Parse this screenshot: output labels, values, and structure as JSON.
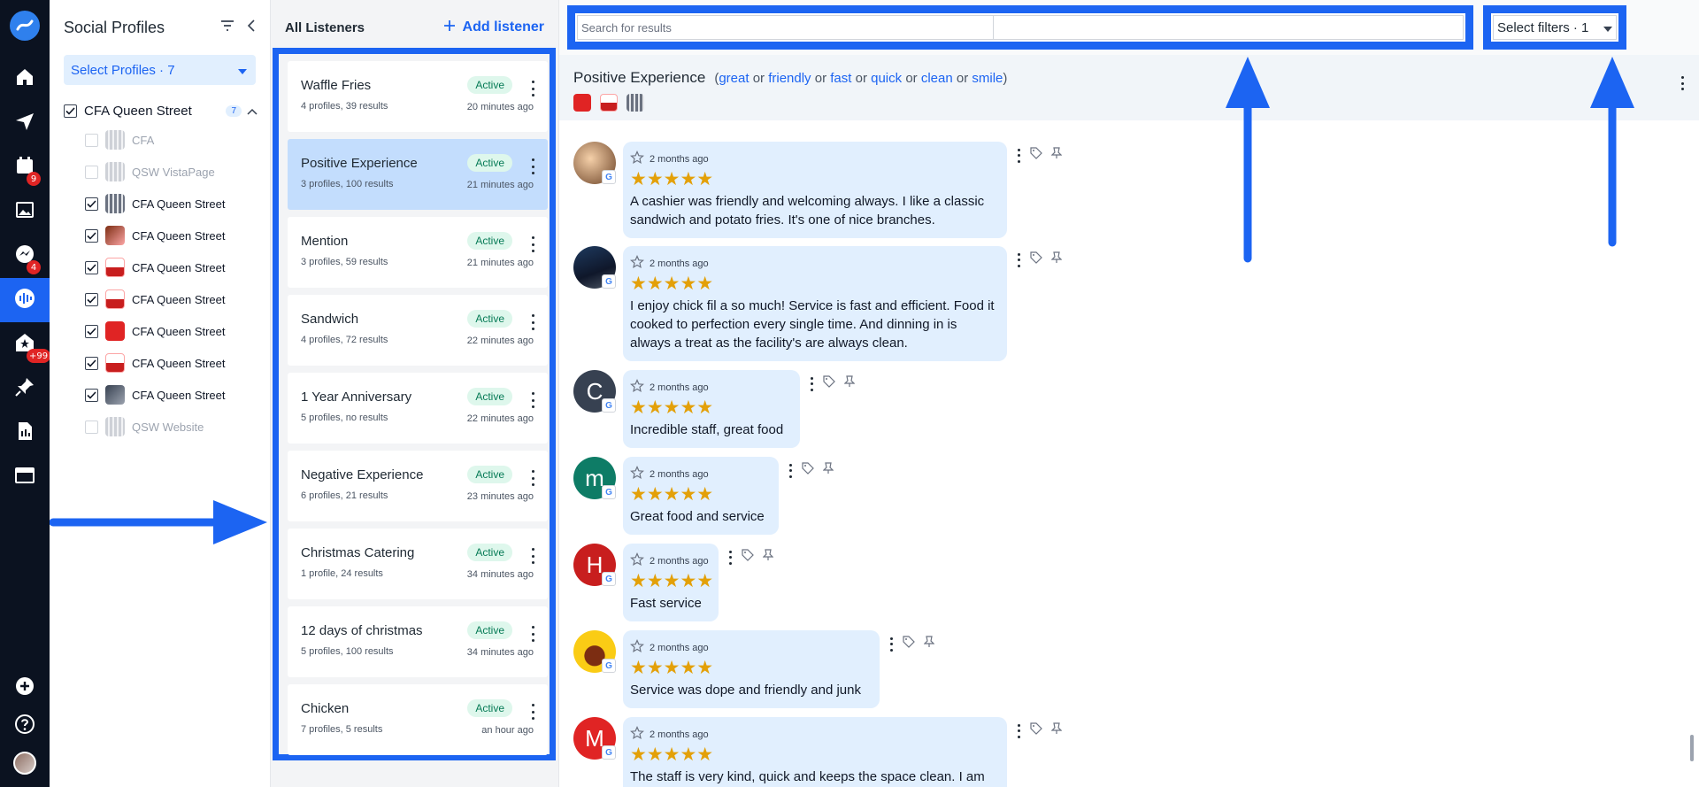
{
  "rail": {
    "items": [
      {
        "icon": "home-icon"
      },
      {
        "icon": "send-icon"
      },
      {
        "icon": "calendar-icon",
        "badge": "9"
      },
      {
        "icon": "image-icon"
      },
      {
        "icon": "messenger-icon",
        "badge": "4"
      },
      {
        "icon": "listening-icon",
        "active": true
      },
      {
        "icon": "reviews-icon",
        "badge": "+99"
      },
      {
        "icon": "pin-icon"
      },
      {
        "icon": "report-icon"
      },
      {
        "icon": "browser-icon"
      }
    ]
  },
  "profiles": {
    "title": "Social Profiles",
    "select_label": "Select Profiles · 7",
    "group": {
      "label": "CFA Queen Street",
      "count": "7"
    },
    "items": [
      {
        "label": "CFA",
        "checked": false,
        "dim": true
      },
      {
        "label": "QSW VistaPage",
        "checked": false,
        "dim": true
      },
      {
        "label": "CFA Queen Street",
        "checked": true
      },
      {
        "label": "CFA Queen Street",
        "checked": true
      },
      {
        "label": "CFA Queen Street",
        "checked": true
      },
      {
        "label": "CFA Queen Street",
        "checked": true
      },
      {
        "label": "CFA Queen Street",
        "checked": true
      },
      {
        "label": "CFA Queen Street",
        "checked": true
      },
      {
        "label": "CFA Queen Street",
        "checked": true
      },
      {
        "label": "QSW Website",
        "checked": false,
        "dim": true
      }
    ]
  },
  "listeners": {
    "title": "All Listeners",
    "add_label": "Add listener",
    "items": [
      {
        "name": "Waffle Fries",
        "meta": "4 profiles, 39 results",
        "status": "Active",
        "time": "20 minutes ago"
      },
      {
        "name": "Positive Experience",
        "meta": "3 profiles, 100 results",
        "status": "Active",
        "time": "21 minutes ago",
        "selected": true
      },
      {
        "name": "Mention",
        "meta": "3 profiles, 59 results",
        "status": "Active",
        "time": "21 minutes ago"
      },
      {
        "name": "Sandwich",
        "meta": "4 profiles, 72 results",
        "status": "Active",
        "time": "22 minutes ago"
      },
      {
        "name": "1 Year Anniversary",
        "meta": "5 profiles, no results",
        "status": "Active",
        "time": "22 minutes ago"
      },
      {
        "name": "Negative Experience",
        "meta": "6 profiles, 21 results",
        "status": "Active",
        "time": "23 minutes ago"
      },
      {
        "name": "Christmas Catering",
        "meta": "1 profile, 24 results",
        "status": "Active",
        "time": "34 minutes ago"
      },
      {
        "name": "12 days of christmas",
        "meta": "5 profiles, 100 results",
        "status": "Active",
        "time": "34 minutes ago"
      },
      {
        "name": "Chicken",
        "meta": "7 profiles, 5 results",
        "status": "Active",
        "time": "an hour ago"
      }
    ]
  },
  "search": {
    "placeholder": "Search for results"
  },
  "filters": {
    "label": "Select filters · 1"
  },
  "active_listener": {
    "title": "Positive Experience",
    "keywords": [
      "great",
      "friendly",
      "fast",
      "quick",
      "clean",
      "smile"
    ],
    "or_word": "or"
  },
  "reviews": [
    {
      "avatar": "photo",
      "time": "2 months ago",
      "stars": "★★★★★",
      "text": "A cashier was friendly and welcoming always. I like a classic sandwich and potato fries. It's one of nice branches."
    },
    {
      "avatar": "photo-dark",
      "time": "2 months ago",
      "stars": "★★★★★",
      "text": "I enjoy chick fil a so much! Service is fast and efficient. Food it cooked to perfection every single time. And dinning in is always a treat as the facility's are always clean."
    },
    {
      "avatar": "C",
      "color": "#374151",
      "time": "2 months ago",
      "stars": "★★★★★",
      "text": "Incredible staff, great food"
    },
    {
      "avatar": "m",
      "color": "#0e7c66",
      "time": "2 months ago",
      "stars": "★★★★★",
      "text": "Great food and service"
    },
    {
      "avatar": "H",
      "color": "#c81e1e",
      "time": "2 months ago",
      "stars": "★★★★★",
      "text": "Fast service"
    },
    {
      "avatar": "photo-yellow",
      "time": "2 months ago",
      "stars": "★★★★★",
      "text": "Service was dope and friendly and junk"
    },
    {
      "avatar": "M",
      "color": "#e02424",
      "time": "2 months ago",
      "stars": "★★★★★",
      "text": "The staff is very kind, quick and keeps the space clean. I am"
    }
  ],
  "colors": {
    "accent": "#1c64f2",
    "rail": "#0b1220",
    "active_badge_bg": "#def7ec",
    "star": "#e3a008"
  }
}
